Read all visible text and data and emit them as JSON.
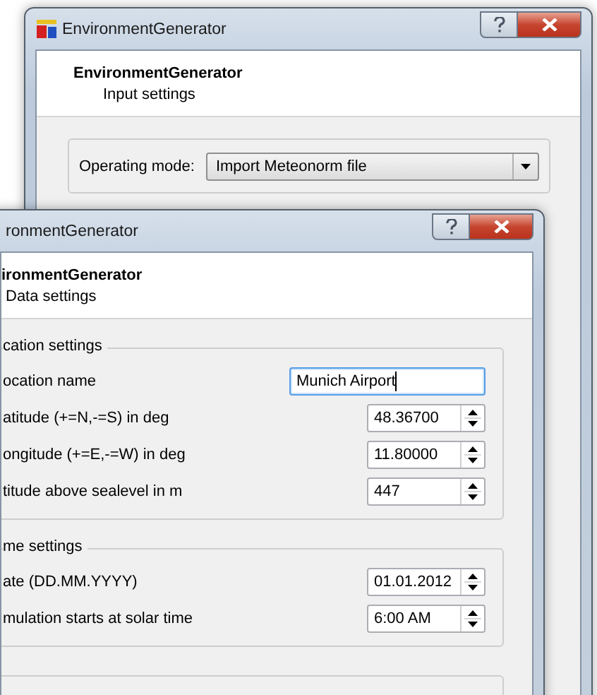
{
  "windows": [
    {
      "title": "EnvironmentGenerator",
      "heading": "EnvironmentGenerator",
      "subheading": "Input settings",
      "groups": [
        {
          "fields": [
            {
              "kind": "combo",
              "label": "Operating mode:",
              "value": "Import Meteonorm file"
            }
          ]
        }
      ]
    },
    {
      "title": "ronmentGenerator",
      "heading": "ironmentGenerator",
      "subheading": "Data settings",
      "groups": [
        {
          "title": "cation settings",
          "fields": [
            {
              "kind": "text",
              "label": "ocation name",
              "value": "Munich Airport",
              "focused": true
            },
            {
              "kind": "spin",
              "label": "atitude (+=N,-=S) in deg",
              "value": "48.36700"
            },
            {
              "kind": "spin",
              "label": "ongitude (+=E,-=W) in deg",
              "value": "11.80000"
            },
            {
              "kind": "spin",
              "label": "titude above sealevel in m",
              "value": "447"
            }
          ]
        },
        {
          "title": "me settings",
          "fields": [
            {
              "kind": "spin",
              "label": "ate (DD.MM.YYYY)",
              "value": "01.01.2012"
            },
            {
              "kind": "spin",
              "label": "mulation starts at solar time",
              "value": "6:00 AM"
            }
          ]
        }
      ]
    }
  ]
}
